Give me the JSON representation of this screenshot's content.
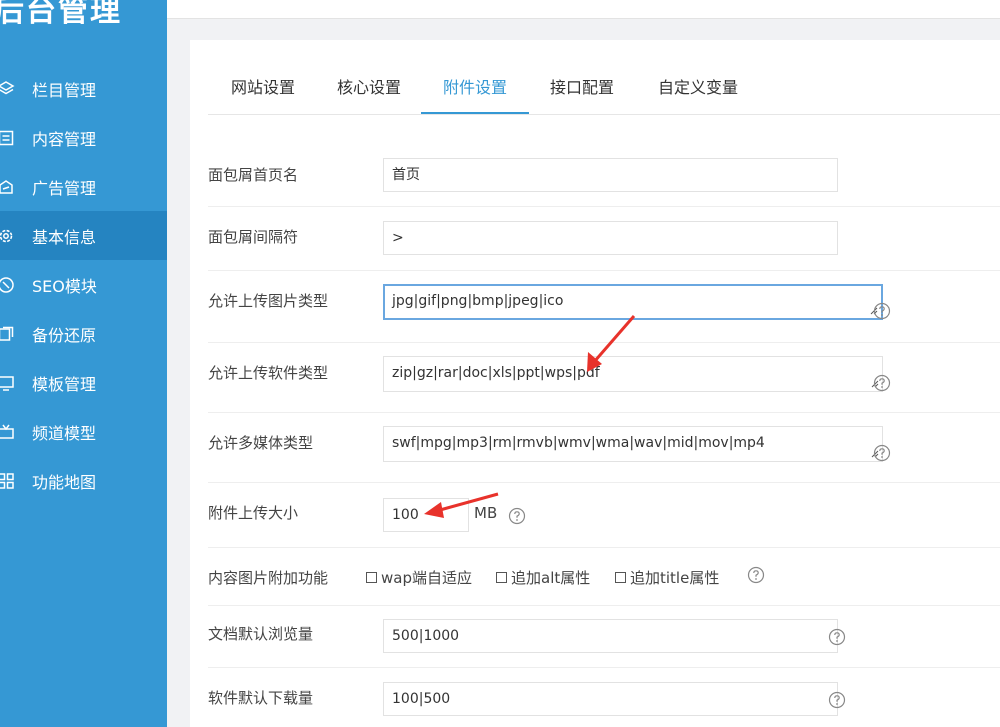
{
  "sidebar": {
    "brand": "后台管理",
    "items": [
      {
        "label": "栏目管理",
        "icon": "layers-icon"
      },
      {
        "label": "内容管理",
        "icon": "document-list-icon"
      },
      {
        "label": "广告管理",
        "icon": "ad-icon"
      },
      {
        "label": "基本信息",
        "icon": "gear-icon",
        "active": true
      },
      {
        "label": "SEO模块",
        "icon": "seo-icon"
      },
      {
        "label": "备份还原",
        "icon": "backup-icon"
      },
      {
        "label": "模板管理",
        "icon": "monitor-icon"
      },
      {
        "label": "频道模型",
        "icon": "tv-icon"
      },
      {
        "label": "功能地图",
        "icon": "grid-icon"
      }
    ]
  },
  "tabs": [
    "网站设置",
    "核心设置",
    "附件设置",
    "接口配置",
    "自定义变量"
  ],
  "active_tab": "附件设置",
  "form": {
    "breadcrumb_home_label": "面包屑首页名",
    "breadcrumb_home_value": "首页",
    "breadcrumb_sep_label": "面包屑间隔符",
    "breadcrumb_sep_value": ">",
    "image_types_label": "允许上传图片类型",
    "image_types_value": "jpg|gif|png|bmp|jpeg|ico",
    "soft_types_label": "允许上传软件类型",
    "soft_types_value": "zip|gz|rar|doc|xls|ppt|wps|pdf",
    "media_types_label": "允许多媒体类型",
    "media_types_value": "swf|mpg|mp3|rm|rmvb|wmv|wma|wav|mid|mov|mp4",
    "upload_size_label": "附件上传大小",
    "upload_size_value": "100",
    "upload_size_unit": "MB",
    "image_extra_label": "内容图片附加功能",
    "image_extra_options": [
      "wap端自适应",
      "追加alt属性",
      "追加title属性"
    ],
    "doc_views_label": "文档默认浏览量",
    "doc_views_value": "500|1000",
    "soft_downloads_label": "软件默认下载量",
    "soft_downloads_value": "100|500"
  },
  "colors": {
    "sidebar": "#3598d4",
    "sidebar_active": "#2584c1",
    "accent": "#3598d4",
    "annotation_arrow": "#e8322b"
  }
}
